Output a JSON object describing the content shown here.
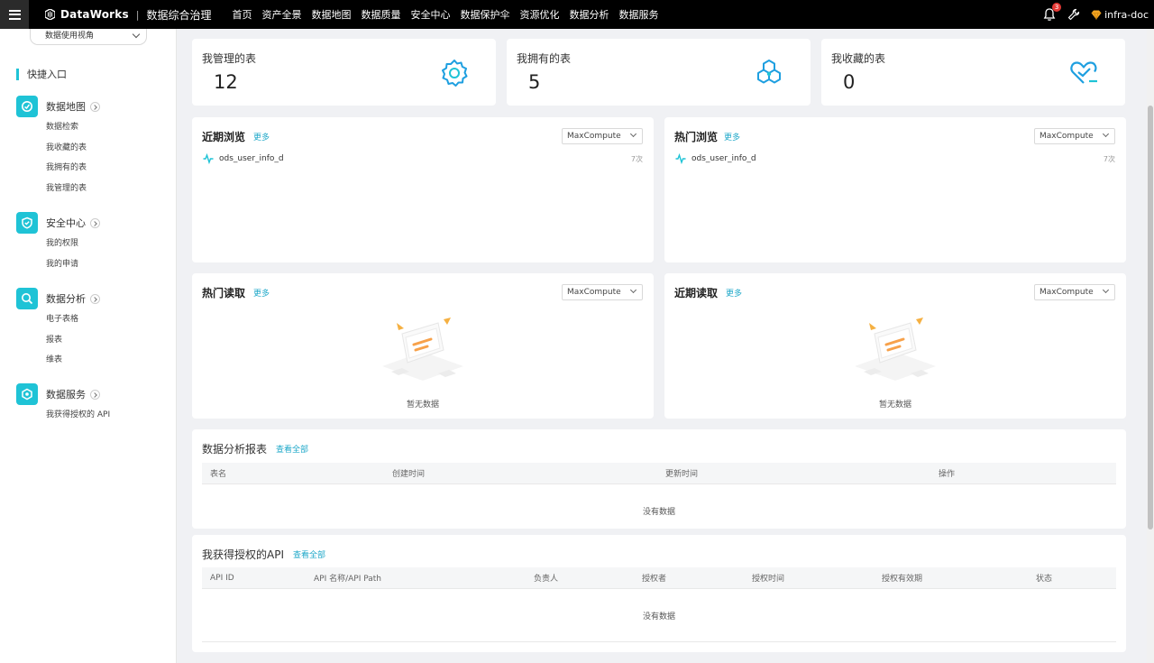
{
  "topbar": {
    "brand": "DataWorks",
    "separator": "|",
    "subtitle": "数据综合治理",
    "nav": [
      "首页",
      "资产全景",
      "数据地图",
      "数据质量",
      "安全中心",
      "数据保护伞",
      "资源优化",
      "数据分析",
      "数据服务"
    ],
    "notification_count": "3",
    "user": "infra-doc"
  },
  "sidebar": {
    "view_select": "数据使用视角",
    "quick_title": "快捷入口",
    "groups": [
      {
        "title": "数据地图",
        "icon": "data-map-icon",
        "items": [
          "数据检索",
          "我收藏的表",
          "我拥有的表",
          "我管理的表"
        ]
      },
      {
        "title": "安全中心",
        "icon": "security-shield-icon",
        "items": [
          "我的权限",
          "我的申请"
        ]
      },
      {
        "title": "数据分析",
        "icon": "data-analysis-icon",
        "items": [
          "电子表格",
          "报表",
          "维表"
        ]
      },
      {
        "title": "数据服务",
        "icon": "data-service-icon",
        "items": [
          "我获得授权的 API"
        ]
      }
    ]
  },
  "stats": [
    {
      "title": "我管理的表",
      "value": "12",
      "icon": "gear-icon"
    },
    {
      "title": "我拥有的表",
      "value": "5",
      "icon": "hexagon-cube-icon"
    },
    {
      "title": "我收藏的表",
      "value": "0",
      "icon": "heart-minus-icon"
    }
  ],
  "panels": {
    "recent_browse": {
      "title": "近期浏览",
      "more": "更多",
      "select": "MaxCompute",
      "item": "ods_user_info_d",
      "count": "7次"
    },
    "hot_browse": {
      "title": "热门浏览",
      "more": "更多",
      "select": "MaxCompute",
      "item": "ods_user_info_d",
      "count": "7次"
    },
    "hot_read": {
      "title": "热门读取",
      "more": "更多",
      "select": "MaxCompute",
      "empty": "暂无数据"
    },
    "recent_read": {
      "title": "近期读取",
      "more": "更多",
      "select": "MaxCompute",
      "empty": "暂无数据"
    }
  },
  "reports": {
    "title": "数据分析报表",
    "view_all": "查看全部",
    "columns": [
      "表名",
      "创建时间",
      "更新时间",
      "操作"
    ],
    "empty": "没有数据"
  },
  "apis": {
    "title": "我获得授权的API",
    "view_all": "查看全部",
    "columns": [
      "API ID",
      "API 名称/API Path",
      "负责人",
      "授权者",
      "授权时间",
      "授权有效期",
      "状态"
    ],
    "empty": "没有数据"
  },
  "colors": {
    "accent": "#1fc3d6",
    "link": "#1fa8c9",
    "icon_blue": "#1e9fe0",
    "topbar": "#000000"
  }
}
